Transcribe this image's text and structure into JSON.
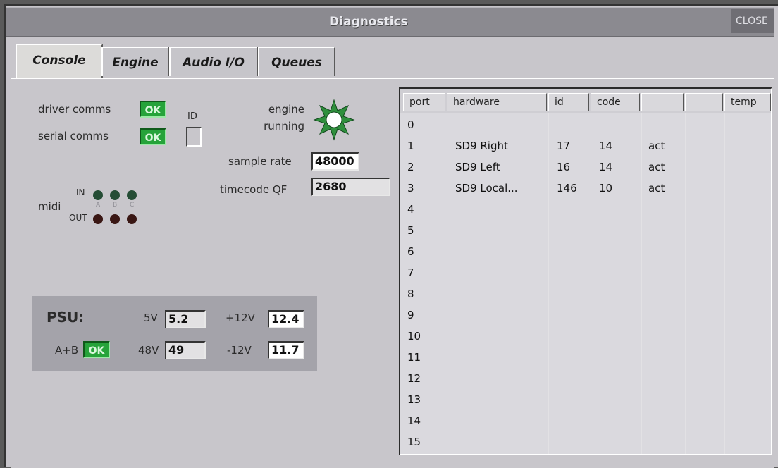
{
  "window": {
    "title": "Diagnostics",
    "close_label": "CLOSE"
  },
  "tabs": [
    {
      "label": "Console",
      "active": true
    },
    {
      "label": "Engine",
      "active": false
    },
    {
      "label": "Audio I/O",
      "active": false
    },
    {
      "label": "Queues",
      "active": false
    }
  ],
  "status": {
    "driver_comms_label": "driver comms",
    "driver_comms_value": "OK",
    "serial_comms_label": "serial comms",
    "serial_comms_value": "OK",
    "id_label": "ID",
    "engine_running_line1": "engine",
    "engine_running_line2": "running",
    "engine_icon": "star-burst-icon",
    "sample_rate_label": "sample rate",
    "sample_rate_value": "48000",
    "timecode_label": "timecode QF",
    "timecode_value": "2680"
  },
  "midi": {
    "label": "midi",
    "in_label": "IN",
    "out_label": "OUT",
    "port_letters": [
      "A",
      "B",
      "C"
    ]
  },
  "psu": {
    "title": "PSU:",
    "v5_label": "5V",
    "v5_value": "5.2",
    "v12p_label": "+12V",
    "v12p_value": "12.4",
    "v48_label": "48V",
    "v48_value": "49",
    "v12n_label": "-12V",
    "v12n_value": "11.7",
    "ab_label": "A+B",
    "ab_value": "OK"
  },
  "table": {
    "columns": [
      "port",
      "hardware",
      "id",
      "code",
      "",
      "",
      "temp"
    ],
    "rows": [
      [
        "0",
        "",
        "",
        "",
        "",
        "",
        ""
      ],
      [
        "1",
        "SD9 Right",
        "17",
        "14",
        "act",
        "",
        ""
      ],
      [
        "2",
        "SD9 Left",
        "16",
        "14",
        "act",
        "",
        ""
      ],
      [
        "3",
        "SD9 Local...",
        "146",
        "10",
        "act",
        "",
        ""
      ],
      [
        "4",
        "",
        "",
        "",
        "",
        "",
        ""
      ],
      [
        "5",
        "",
        "",
        "",
        "",
        "",
        ""
      ],
      [
        "6",
        "",
        "",
        "",
        "",
        "",
        ""
      ],
      [
        "7",
        "",
        "",
        "",
        "",
        "",
        ""
      ],
      [
        "8",
        "",
        "",
        "",
        "",
        "",
        ""
      ],
      [
        "9",
        "",
        "",
        "",
        "",
        "",
        ""
      ],
      [
        "10",
        "",
        "",
        "",
        "",
        "",
        ""
      ],
      [
        "11",
        "",
        "",
        "",
        "",
        "",
        ""
      ],
      [
        "12",
        "",
        "",
        "",
        "",
        "",
        ""
      ],
      [
        "13",
        "",
        "",
        "",
        "",
        "",
        ""
      ],
      [
        "14",
        "",
        "",
        "",
        "",
        "",
        ""
      ],
      [
        "15",
        "",
        "",
        "",
        "",
        "",
        ""
      ]
    ]
  },
  "colors": {
    "ok_green": "#26a33a",
    "title_bar": "#8b8a90",
    "panel": "#c8c6cb"
  }
}
